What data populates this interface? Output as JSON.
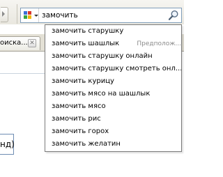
{
  "search": {
    "query": "замочить"
  },
  "tab": {
    "title": "оиска..."
  },
  "page": {
    "fragment": "нд)"
  },
  "suggestions": [
    {
      "text": "замочить старушку"
    },
    {
      "text": "замочить шашлык",
      "hint": "Предполож..."
    },
    {
      "text": "замочить старушку онлайн"
    },
    {
      "text": "замочить старушку смотреть онл..."
    },
    {
      "text": "замочить курицу"
    },
    {
      "text": "замочить мясо на шашлык"
    },
    {
      "text": "замочить мясо"
    },
    {
      "text": "замочить рис"
    },
    {
      "text": "замочить горох"
    },
    {
      "text": "замочить желатин"
    }
  ],
  "icons": {
    "engine": "google-icon",
    "go": "magnifier-icon",
    "tab_close": "close-icon"
  }
}
